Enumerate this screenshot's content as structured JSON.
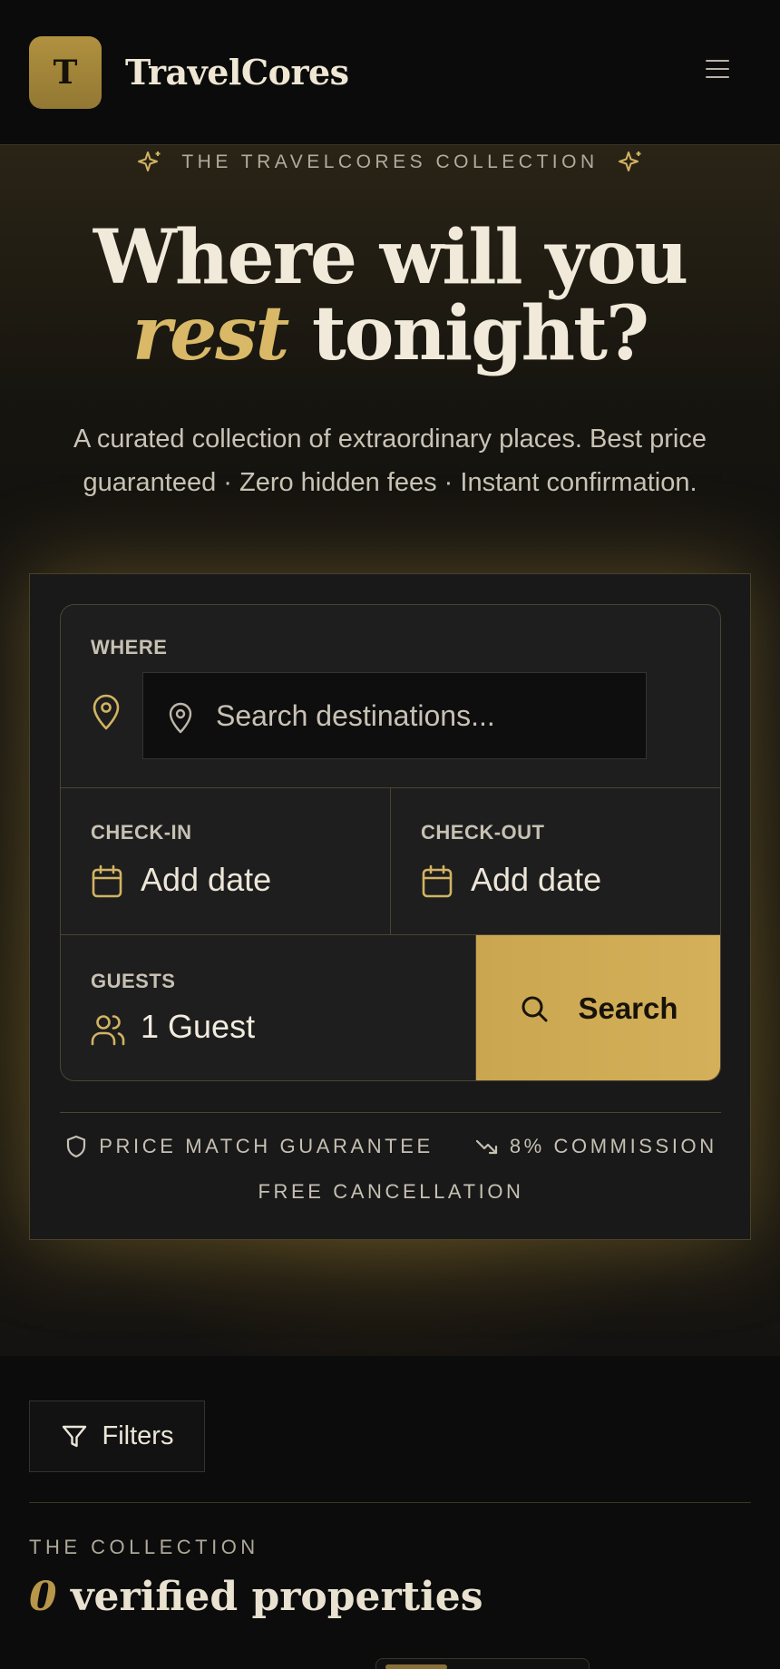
{
  "header": {
    "logo_letter": "T",
    "brand": "TravelCores",
    "menu_icon": "hamburger-menu-icon"
  },
  "hero": {
    "eyebrow": "THE TRAVELCORES COLLECTION",
    "headline_line1": "Where will you",
    "headline_accent": "rest",
    "headline_line2_rest": " tonight?",
    "subtitle": "A curated collection of extraordinary places. Best price guaranteed · Zero hidden fees · Instant confirmation."
  },
  "search": {
    "where_label": "WHERE",
    "where_placeholder": "Search destinations...",
    "checkin_label": "CHECK-IN",
    "checkin_value": "Add date",
    "checkout_label": "CHECK-OUT",
    "checkout_value": "Add date",
    "guests_label": "GUESTS",
    "guests_value": "1 Guest",
    "search_button": "Search"
  },
  "trust": {
    "item1": "PRICE MATCH GUARANTEE",
    "item2": "8% COMMISSION",
    "item3": "FREE CANCELLATION"
  },
  "collection": {
    "filters_button": "Filters",
    "eyebrow": "THE COLLECTION",
    "count": "0",
    "title_rest": " verified properties"
  },
  "colors": {
    "accent_gold": "#d5b05a",
    "background": "#0c0c0c",
    "card": "#191919"
  }
}
